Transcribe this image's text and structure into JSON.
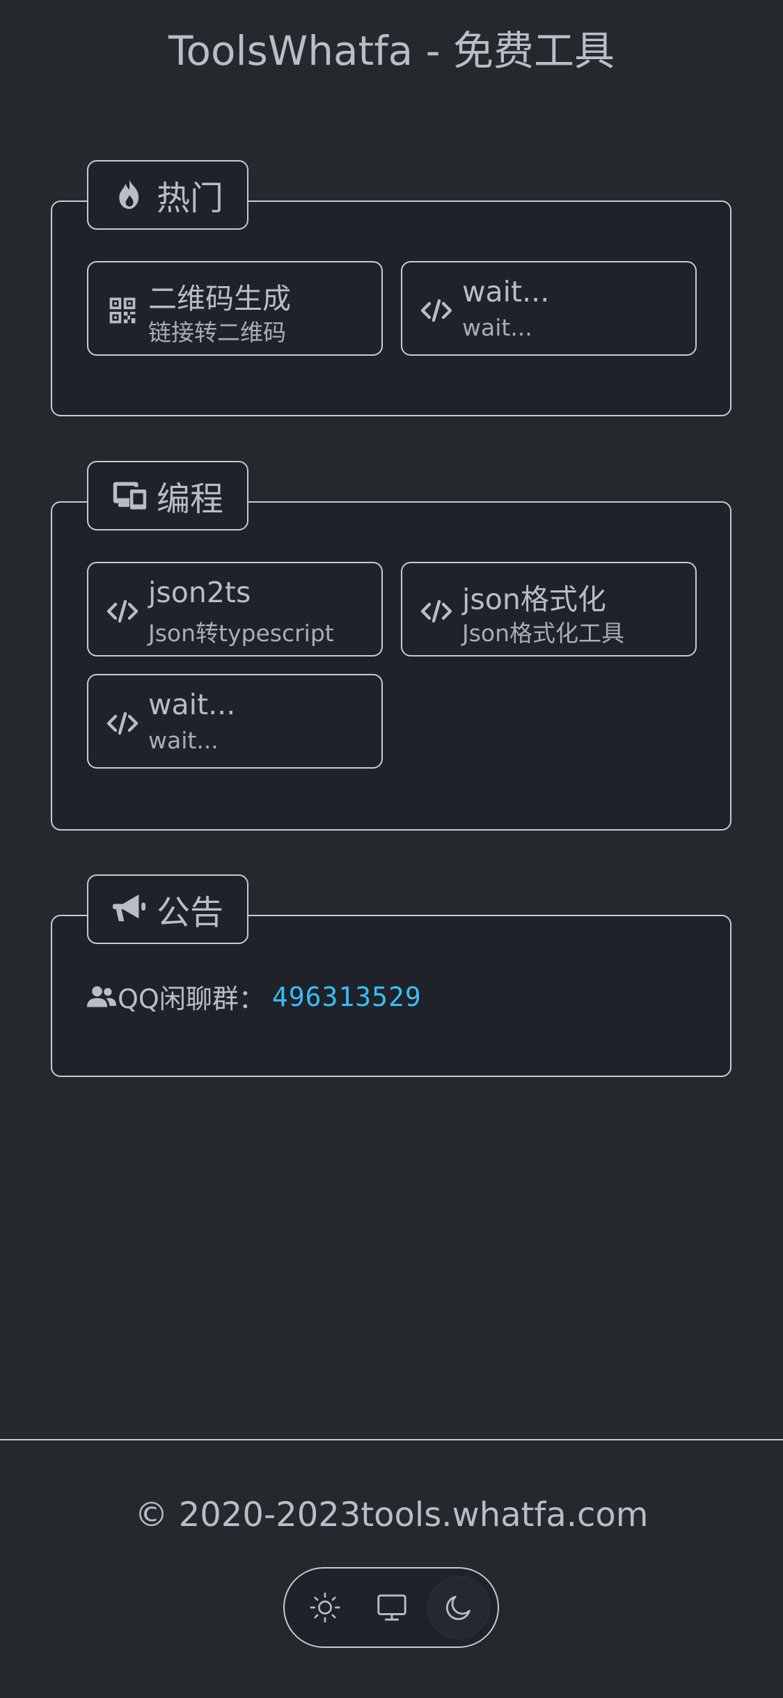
{
  "header": {
    "title": "ToolsWhatfa - 免费工具"
  },
  "sections": {
    "hot": {
      "label": "热门",
      "icon": "fire-icon",
      "cards": [
        {
          "title": "二维码生成",
          "subtitle": "链接转二维码",
          "icon": "qrcode-icon"
        },
        {
          "title": "wait...",
          "subtitle": "wait...",
          "icon": "code-icon"
        }
      ]
    },
    "programming": {
      "label": "编程",
      "icon": "devices-icon",
      "cards": [
        {
          "title": "json2ts",
          "subtitle": "Json转typescript",
          "icon": "code-icon"
        },
        {
          "title": "json格式化",
          "subtitle": "Json格式化工具",
          "icon": "code-icon"
        },
        {
          "title": "wait...",
          "subtitle": "wait...",
          "icon": "code-icon"
        }
      ]
    },
    "notice": {
      "label": "公告",
      "icon": "megaphone-icon",
      "text_label": "QQ闲聊群：",
      "qq_number": "496313529",
      "qq_color": "#38bdf8"
    }
  },
  "footer": {
    "copyright": "© 2020-2023tools.whatfa.com",
    "theme_options": [
      "light",
      "system",
      "dark"
    ],
    "active_theme": "dark"
  }
}
